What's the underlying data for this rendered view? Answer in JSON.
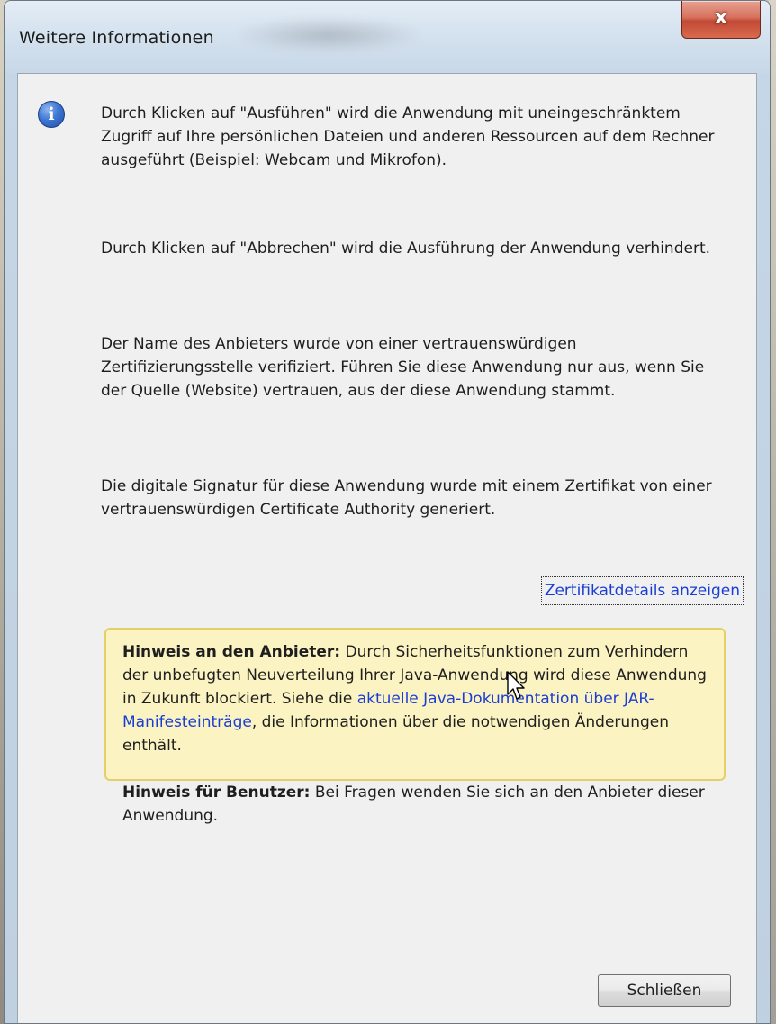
{
  "window": {
    "title": "Weitere Informationen",
    "close_glyph": "x"
  },
  "icons": {
    "info": "info-icon",
    "info_glyph": "i",
    "cursor": "arrow-cursor-icon"
  },
  "paragraphs": {
    "p1": "Durch Klicken auf \"Ausführen\" wird die Anwendung mit uneingeschränktem Zugriff auf Ihre persönlichen Dateien und anderen Ressourcen auf dem Rechner ausgeführt (Beispiel: Webcam und Mikrofon).",
    "p2": "Durch Klicken auf \"Abbrechen\" wird die Ausführung der Anwendung verhindert.",
    "p3": "Der Name des Anbieters wurde von einer vertrauenswürdigen Zertifizierungsstelle verifiziert. Führen Sie diese Anwendung nur aus, wenn Sie der Quelle (Website) vertrauen, aus der diese Anwendung stammt.",
    "p4": "Die digitale Signatur für diese Anwendung wurde mit einem Zertifikat von einer vertrauenswürdigen Certificate Authority generiert."
  },
  "cert_link": "Zertifikatdetails anzeigen",
  "notice": {
    "provider_heading": "Hinweis an den Anbieter:",
    "provider_text": " Durch Sicherheitsfunktionen zum Verhindern der unbefugten Neuverteilung Ihrer Java-Anwendung wird diese Anwendung in Zukunft blockiert. Siehe die ",
    "provider_link": "aktuelle Java-Dokumentation über JAR-Manifesteinträge",
    "provider_tail": ", die Informationen über die notwendigen Änderungen enthält.",
    "user_heading": "Hinweis für Benutzer:",
    "user_text": " Bei Fragen wenden Sie sich an den Anbieter dieser Anwendung."
  },
  "buttons": {
    "close": "Schließen"
  },
  "colors": {
    "link": "#1a3ed4",
    "notice_bg": "#fbf3c1",
    "notice_border": "#e4cf69",
    "close_red": "#c24a35"
  }
}
